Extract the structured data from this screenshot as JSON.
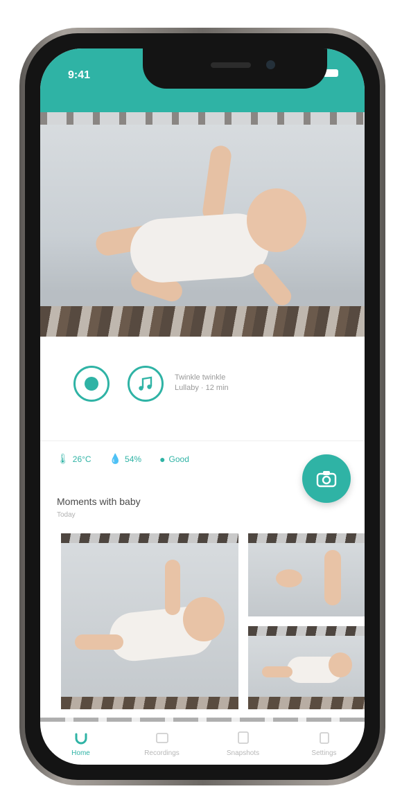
{
  "status_bar": {
    "time": "9:41"
  },
  "controls": {
    "lullaby_line1": "Twinkle twinkle",
    "lullaby_line2": "Lullaby · 12 min"
  },
  "sensors": [
    {
      "icon": "thermometer-icon",
      "value": "26°C"
    },
    {
      "icon": "humidity-icon",
      "value": "54%"
    },
    {
      "icon": "air-icon",
      "value": "Good"
    }
  ],
  "gallery": {
    "title": "Moments with baby",
    "subtitle": "Today"
  },
  "tabs": [
    {
      "label": "Home",
      "icon": "home-icon",
      "active": true
    },
    {
      "label": "Recordings",
      "icon": "recordings-icon",
      "active": false
    },
    {
      "label": "Snapshots",
      "icon": "snapshots-icon",
      "active": false
    },
    {
      "label": "Settings",
      "icon": "settings-icon",
      "active": false
    }
  ],
  "colors": {
    "accent": "#2fb3a5",
    "inactive": "#b8b8b8"
  }
}
